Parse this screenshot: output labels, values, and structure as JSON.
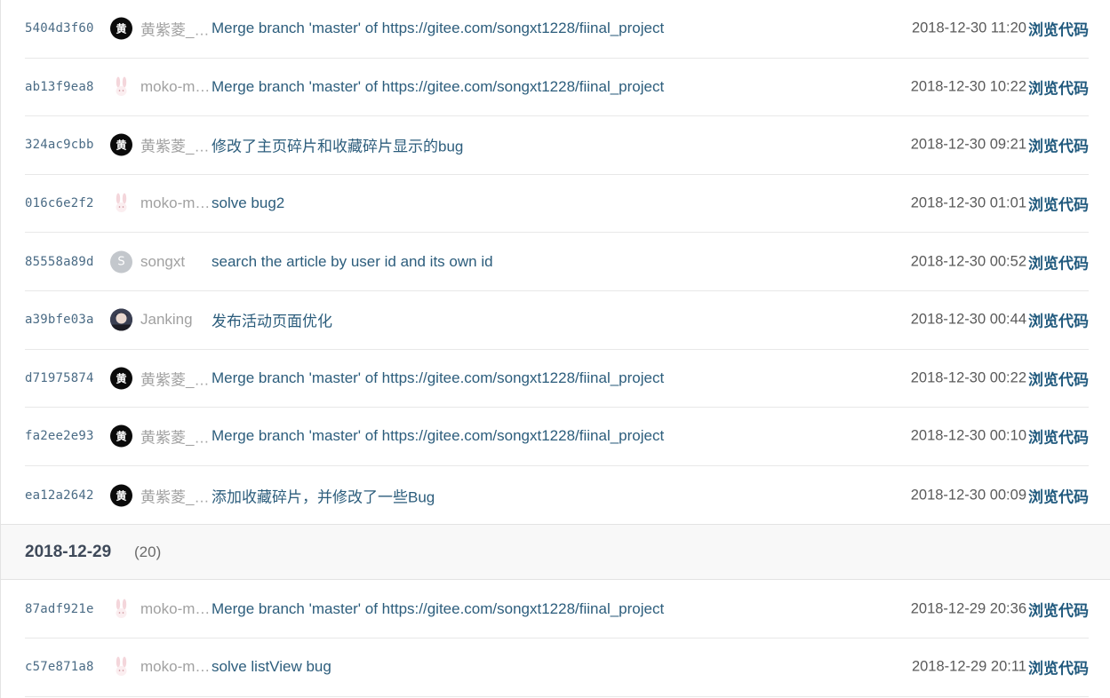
{
  "groups": [
    {
      "date": "",
      "count": "",
      "commits": [
        {
          "sha": "5404d3f60",
          "avatar": "黄",
          "avatar_style": "black",
          "author": "黄紫菱_kreamy",
          "message": "Merge branch 'master' of https://gitee.com/songxt1228/fiinal_project",
          "time": "2018-12-30 11:20",
          "browse": "浏览代码"
        },
        {
          "sha": "ab13f9ea8",
          "avatar": "",
          "avatar_style": "pink",
          "author": "moko-mong",
          "message": "Merge branch 'master' of https://gitee.com/songxt1228/fiinal_project",
          "time": "2018-12-30 10:22",
          "browse": "浏览代码"
        },
        {
          "sha": "324ac9cbb",
          "avatar": "黄",
          "avatar_style": "black",
          "author": "黄紫菱_kreamy",
          "message": "修改了主页碎片和收藏碎片显示的bug",
          "time": "2018-12-30 09:21",
          "browse": "浏览代码"
        },
        {
          "sha": "016c6e2f2",
          "avatar": "",
          "avatar_style": "pink",
          "author": "moko-mong",
          "message": "solve bug2",
          "time": "2018-12-30 01:01",
          "browse": "浏览代码"
        },
        {
          "sha": "85558a89d",
          "avatar": "S",
          "avatar_style": "gray",
          "author": "songxt",
          "message": "search the article by user id and its own id",
          "time": "2018-12-30 00:52",
          "browse": "浏览代码"
        },
        {
          "sha": "a39bfe03a",
          "avatar": "",
          "avatar_style": "photo",
          "author": "Janking",
          "message": "发布活动页面优化",
          "time": "2018-12-30 00:44",
          "browse": "浏览代码"
        },
        {
          "sha": "d71975874",
          "avatar": "黄",
          "avatar_style": "black",
          "author": "黄紫菱_kreamy",
          "message": "Merge branch 'master' of https://gitee.com/songxt1228/fiinal_project",
          "time": "2018-12-30 00:22",
          "browse": "浏览代码"
        },
        {
          "sha": "fa2ee2e93",
          "avatar": "黄",
          "avatar_style": "black",
          "author": "黄紫菱_kreamy",
          "message": "Merge branch 'master' of https://gitee.com/songxt1228/fiinal_project",
          "time": "2018-12-30 00:10",
          "browse": "浏览代码"
        },
        {
          "sha": "ea12a2642",
          "avatar": "黄",
          "avatar_style": "black",
          "author": "黄紫菱_kreamy",
          "message": "添加收藏碎片，并修改了一些Bug",
          "time": "2018-12-30 00:09",
          "browse": "浏览代码"
        }
      ]
    },
    {
      "date": "2018-12-29",
      "count": "(20)",
      "commits": [
        {
          "sha": "87adf921e",
          "avatar": "",
          "avatar_style": "pink",
          "author": "moko-mong",
          "message": "Merge branch 'master' of https://gitee.com/songxt1228/fiinal_project",
          "time": "2018-12-29 20:36",
          "browse": "浏览代码"
        },
        {
          "sha": "c57e871a8",
          "avatar": "",
          "avatar_style": "pink",
          "author": "moko-mong",
          "message": "solve listView bug",
          "time": "2018-12-29 20:11",
          "browse": "浏览代码"
        }
      ]
    }
  ],
  "colors": {
    "sha": "#4a6b85",
    "message": "#2c5d7c",
    "browse": "#215a7e",
    "author": "#a1a1a1",
    "header_bg": "#f8f8f8"
  }
}
